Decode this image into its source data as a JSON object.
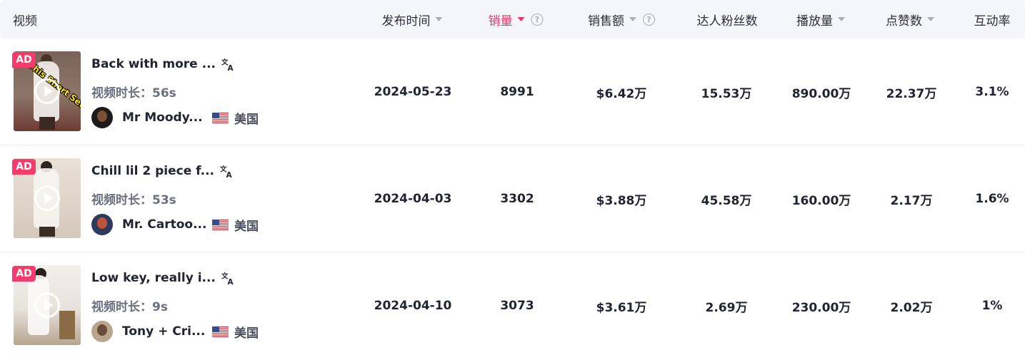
{
  "header": {
    "video": "视频",
    "publish_time": "发布时间",
    "sales": "销量",
    "revenue": "销售额",
    "followers": "达人粉丝数",
    "plays": "播放量",
    "likes": "点赞数",
    "engagement": "互动率",
    "help_glyph": "?"
  },
  "colors": {
    "accent": "#f0306a",
    "ad_badge": "#f53b6b"
  },
  "rows": [
    {
      "ad": "AD",
      "sticker": "This Short Set!",
      "title": "Back with more ...",
      "duration_label": "视频时长：",
      "duration": "56s",
      "creator": "Mr Moody...",
      "country": "美国",
      "date": "2024-05-23",
      "sales": "8991",
      "revenue": "$6.42万",
      "followers": "15.53万",
      "plays": "890.00万",
      "likes": "22.37万",
      "engagement": "3.1%"
    },
    {
      "ad": "AD",
      "sticker": "",
      "title": "Chill lil 2 piece f...",
      "duration_label": "视频时长：",
      "duration": "53s",
      "creator": "Mr. Cartoo...",
      "country": "美国",
      "date": "2024-04-03",
      "sales": "3302",
      "revenue": "$3.88万",
      "followers": "45.58万",
      "plays": "160.00万",
      "likes": "2.17万",
      "engagement": "1.6%"
    },
    {
      "ad": "AD",
      "sticker": "",
      "title": "Low key, really i...",
      "duration_label": "视频时长：",
      "duration": "9s",
      "creator": "Tony + Cri...",
      "country": "美国",
      "date": "2024-04-10",
      "sales": "3073",
      "revenue": "$3.61万",
      "followers": "2.69万",
      "plays": "230.00万",
      "likes": "2.02万",
      "engagement": "1%"
    }
  ]
}
